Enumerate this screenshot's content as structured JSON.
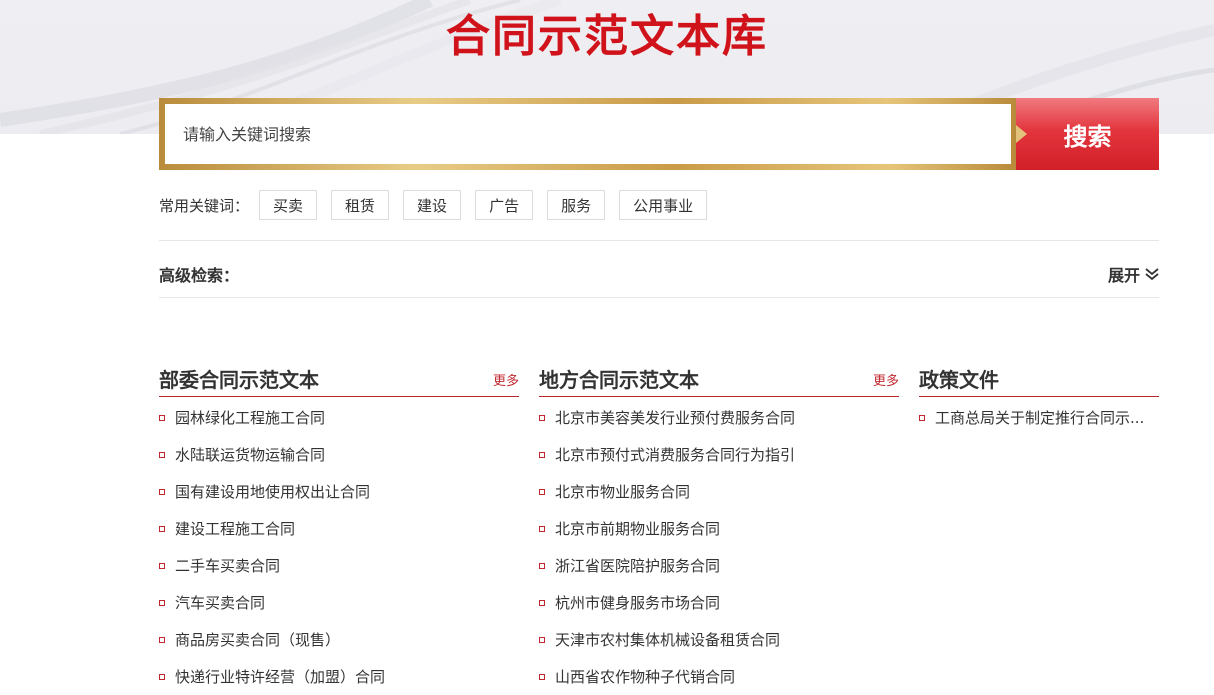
{
  "page_title": "合同示范文本库",
  "search": {
    "placeholder": "请输入关键词搜索",
    "button_label": "搜索"
  },
  "keywords": {
    "label": "常用关键词：",
    "tags": [
      "买卖",
      "租赁",
      "建设",
      "广告",
      "服务",
      "公用事业"
    ]
  },
  "advanced": {
    "label": "高级检索：",
    "expand_label": "展开"
  },
  "columns": [
    {
      "title": "部委合同示范文本",
      "more": "更多",
      "items": [
        "园林绿化工程施工合同",
        "水陆联运货物运输合同",
        "国有建设用地使用权出让合同",
        "建设工程施工合同",
        "二手车买卖合同",
        "汽车买卖合同",
        "商品房买卖合同（现售）",
        "快递行业特许经营（加盟）合同"
      ]
    },
    {
      "title": "地方合同示范文本",
      "more": "更多",
      "items": [
        "北京市美容美发行业预付费服务合同",
        "北京市预付式消费服务合同行为指引",
        "北京市物业服务合同",
        "北京市前期物业服务合同",
        "浙江省医院陪护服务合同",
        "杭州市健身服务市场合同",
        "天津市农村集体机械设备租赁合同",
        "山西省农作物种子代销合同"
      ]
    },
    {
      "title": "政策文件",
      "items": [
        "工商总局关于制定推行合同示..."
      ]
    }
  ],
  "colors": {
    "brand_red": "#d0121b",
    "gold": "#c99b48",
    "link_red": "#c0282f"
  },
  "icons": {
    "expand": "double-chevron-down-icon",
    "bullet": "square-bullet-icon"
  }
}
